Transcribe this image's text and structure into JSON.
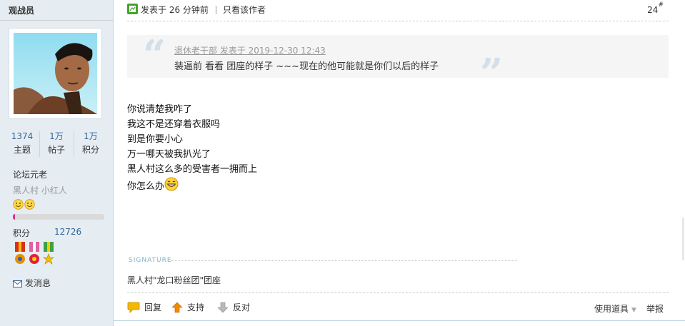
{
  "author": {
    "username": "观战员",
    "stats": [
      {
        "value": "1374",
        "label": "主题"
      },
      {
        "value": "1万",
        "label": "帖子"
      },
      {
        "value": "1万",
        "label": "积分"
      }
    ],
    "rank_title": "论坛元老",
    "rank_subtitle": "黑人村 小红人",
    "rank_progress": 0.02,
    "points_label": "积分",
    "points_value": "12726",
    "send_message": "发消息"
  },
  "post": {
    "time_text": "发表于 26 分钟前",
    "only_author": "只看该作者",
    "floor": "24",
    "floor_mark": "#",
    "quote": {
      "meta": "退休老干部 发表于 2019-12-30 12:43",
      "text": "装逼前 看看 团座的样子 ~~~现在的他可能就是你们以后的样子"
    },
    "body_lines": [
      "你说清楚我咋了",
      "我这不是还穿着衣服吗",
      "到是你要小心",
      "万一哪天被我扒光了",
      "黑人村这么多的受害者一拥而上",
      "你怎么办"
    ],
    "signature_label": "SIGNATURE",
    "signature": "黑人村\"龙口粉丝团\"团座"
  },
  "actions": {
    "reply": "回复",
    "support": "支持",
    "oppose": "反对",
    "use_tools": "使用道具",
    "report": "举报"
  },
  "colors": {
    "sidebar_bg": "#e5edf2",
    "link_blue": "#336699",
    "rank_bar": "#e0308a"
  }
}
